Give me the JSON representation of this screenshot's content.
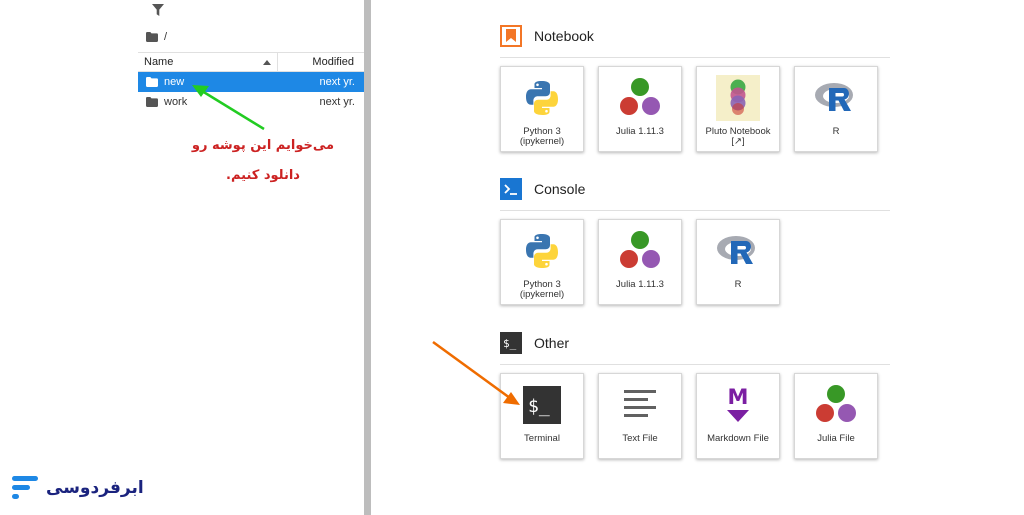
{
  "filebrowser": {
    "breadcrumb": "/",
    "columns": {
      "name": "Name",
      "modified": "Modified"
    },
    "rows": [
      {
        "name": "new",
        "modified": "next yr."
      },
      {
        "name": "work",
        "modified": "next yr."
      }
    ]
  },
  "annotations": {
    "line1": "می‌خوایم این پوشه رو",
    "line2": "دانلود کنیم."
  },
  "launcher": {
    "notebook": {
      "title": "Notebook",
      "cards": [
        {
          "label": "Python 3\n(ipykernel)",
          "icon": "python-icon"
        },
        {
          "label": "Julia 1.11.3",
          "icon": "julia-icon"
        },
        {
          "label": "Pluto Notebook\n[↗]",
          "icon": "pluto-icon"
        },
        {
          "label": "R",
          "icon": "r-icon"
        }
      ]
    },
    "console": {
      "title": "Console",
      "cards": [
        {
          "label": "Python 3\n(ipykernel)",
          "icon": "python-icon"
        },
        {
          "label": "Julia 1.11.3",
          "icon": "julia-icon"
        },
        {
          "label": "R",
          "icon": "r-icon"
        }
      ]
    },
    "other": {
      "title": "Other",
      "cards": [
        {
          "label": "Terminal",
          "icon": "terminal-icon"
        },
        {
          "label": "Text File",
          "icon": "text-file-icon"
        },
        {
          "label": "Markdown File",
          "icon": "markdown-icon"
        },
        {
          "label": "Julia File",
          "icon": "julia-icon"
        }
      ]
    }
  },
  "logo": {
    "text": "ابرفردوسی"
  },
  "colors": {
    "selection": "#1e88e5",
    "notebook_accent": "#f37626",
    "console_accent": "#1976d2",
    "annotation_red": "#cc2222",
    "green_arrow": "#22cc22",
    "orange_arrow": "#ef6c00",
    "logo_blue": "#1a237e"
  }
}
